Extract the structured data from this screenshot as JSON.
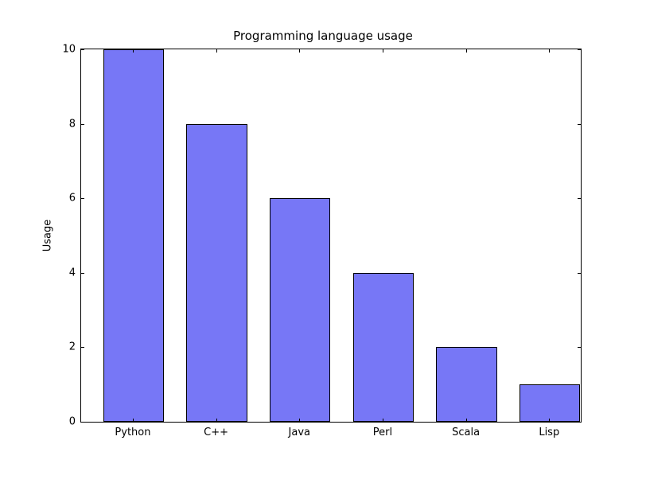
{
  "chart_data": {
    "type": "bar",
    "title": "Programming language usage",
    "xlabel": "",
    "ylabel": "Usage",
    "categories": [
      "Python",
      "C++",
      "Java",
      "Perl",
      "Scala",
      "Lisp"
    ],
    "values": [
      10,
      8,
      6,
      4,
      2,
      1
    ],
    "ylim": [
      0,
      10
    ],
    "yticks": [
      0,
      2,
      4,
      6,
      8,
      10
    ],
    "bar_color": "#7777f6"
  }
}
